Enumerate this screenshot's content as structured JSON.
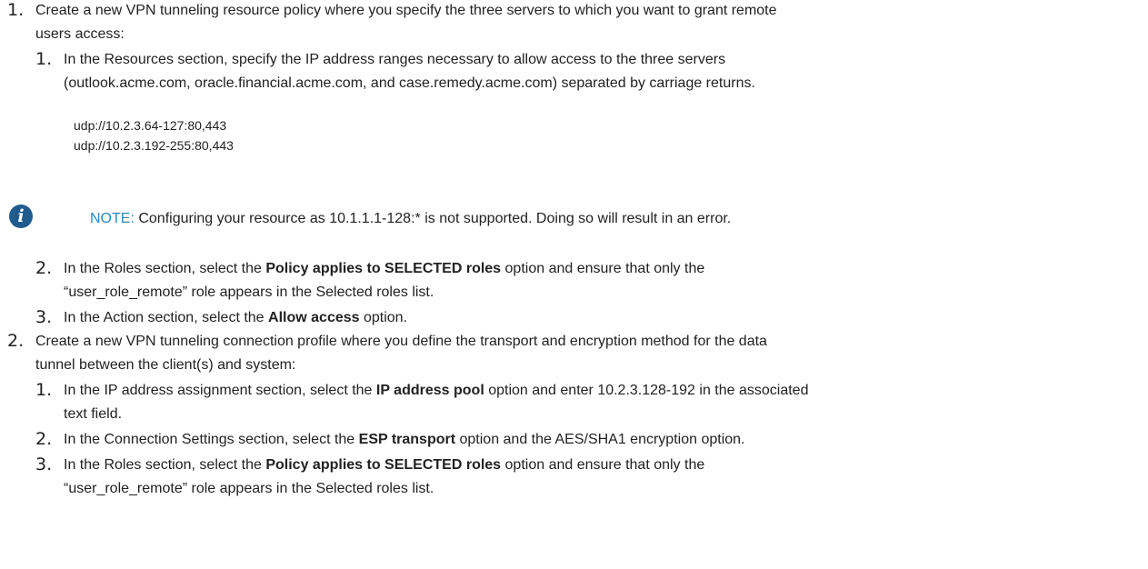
{
  "steps": [
    {
      "number": "1.",
      "text_line1": "Create a new VPN tunneling resource policy where you specify the three servers to which you want to grant remote",
      "text_line2": "users access:",
      "substeps": [
        {
          "number": "1.",
          "text_line1": "In the Resources section, specify the IP address ranges necessary to allow access to the three servers",
          "text_line2": "(outlook.acme.com, oracle.financial.acme.com, and case.remedy.acme.com) separated by carriage returns."
        },
        {
          "number": "2.",
          "line1_prefix": "In the Roles section, select the ",
          "line1_bold": "Policy applies to SELECTED roles",
          "line1_suffix": " option and ensure that only the",
          "line2": "“user_role_remote” role appears in the Selected roles list."
        },
        {
          "number": "3.",
          "prefix": "In the Action section, select the ",
          "bold": "Allow access",
          "suffix": " option."
        }
      ]
    },
    {
      "number": "2.",
      "text_line1": "Create a new VPN tunneling connection profile where you define the transport and encryption method for the data",
      "text_line2": "tunnel between the client(s) and system:",
      "substeps": [
        {
          "number": "1.",
          "line1_prefix": "In the IP address assignment section, select the ",
          "line1_bold": "IP address pool",
          "line1_suffix": " option and enter 10.2.3.128-192 in the associated",
          "line2": "text field."
        },
        {
          "number": "2.",
          "prefix": "In the Connection Settings section, select the ",
          "bold": "ESP transport",
          "suffix": " option and the AES/SHA1 encryption option."
        },
        {
          "number": "3.",
          "line1_prefix": "In the Roles section, select the ",
          "line1_bold": "Policy applies to SELECTED roles",
          "line1_suffix": " option and ensure that only the",
          "line2": "“user_role_remote” role appears in the Selected roles list."
        }
      ]
    }
  ],
  "code_lines": [
    "udp://10.2.3.64-127:80,443",
    "udp://10.2.3.192-255:80,443"
  ],
  "note": {
    "icon": "info-icon",
    "icon_glyph": "i",
    "label": "NOTE:",
    "text": " Configuring your resource as 10.1.1.1-128:* is not supported. Doing so will result in an error."
  },
  "colors": {
    "note_label": "#2a8ab8",
    "icon_bg": "#1f5b8c",
    "text": "#222222"
  }
}
